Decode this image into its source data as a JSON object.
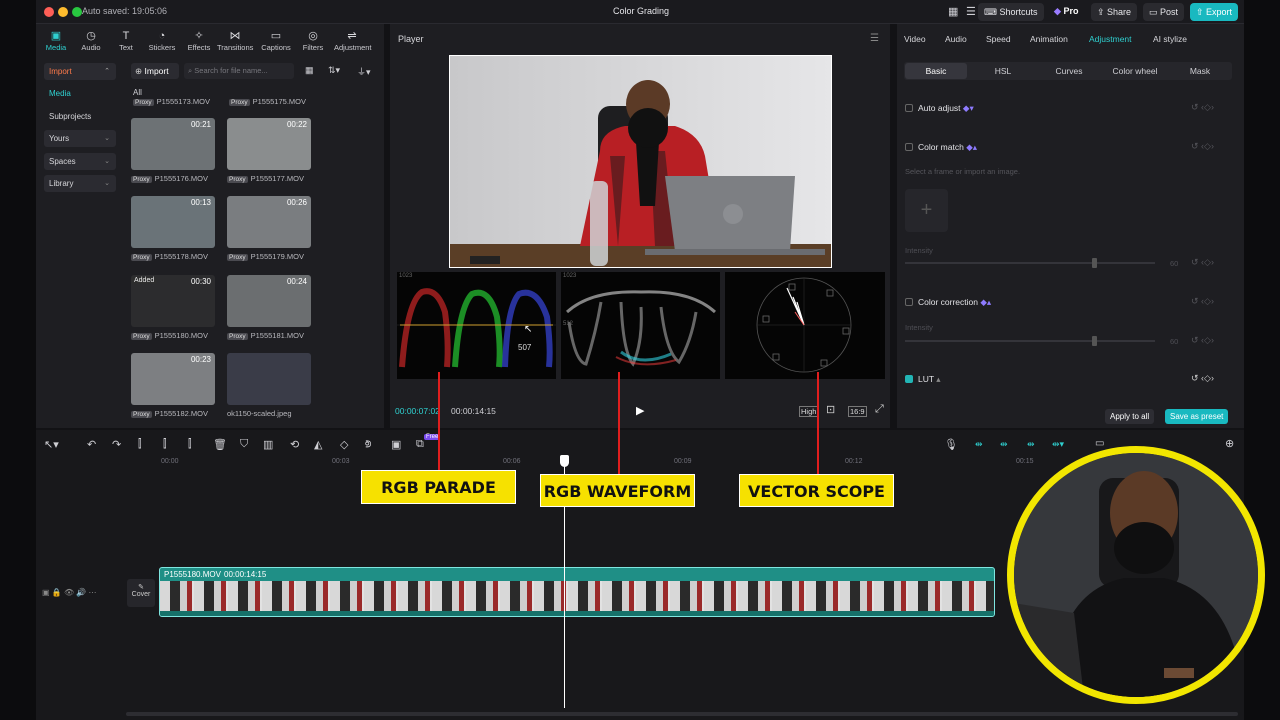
{
  "window": {
    "autosave": "Auto saved: 19:05:06",
    "title": "Color Grading"
  },
  "topbar": {
    "shortcuts": "Shortcuts",
    "pro": "Pro",
    "share": "Share",
    "post": "Post",
    "export": "Export"
  },
  "tools": [
    {
      "label": "Media",
      "icon": "media-icon",
      "glyph": "▣"
    },
    {
      "label": "Audio",
      "icon": "audio-icon",
      "glyph": "◷"
    },
    {
      "label": "Text",
      "icon": "text-icon",
      "glyph": "T"
    },
    {
      "label": "Stickers",
      "icon": "stickers-icon",
      "glyph": "◔"
    },
    {
      "label": "Effects",
      "icon": "effects-icon",
      "glyph": "✧"
    },
    {
      "label": "Transitions",
      "icon": "transitions-icon",
      "glyph": "⋈"
    },
    {
      "label": "Captions",
      "icon": "captions-icon",
      "glyph": "▭"
    },
    {
      "label": "Filters",
      "icon": "filters-icon",
      "glyph": "◎"
    },
    {
      "label": "Adjustment",
      "icon": "adjustment-icon",
      "glyph": "⇌"
    }
  ],
  "sidebar": {
    "import": "Import",
    "items": [
      "Media",
      "Subprojects",
      "Yours",
      "Spaces",
      "Library"
    ]
  },
  "media": {
    "import_button": "Import",
    "search_placeholder": "Search for file name...",
    "filter_all": "All",
    "top_names": [
      "P1555173.MOV",
      "P1555175.MOV"
    ],
    "items": [
      {
        "name": "P1555176.MOV",
        "duration": "00:21",
        "proxy": "Proxy",
        "added": ""
      },
      {
        "name": "P1555177.MOV",
        "duration": "00:22",
        "proxy": "Proxy",
        "added": ""
      },
      {
        "name": "P1555178.MOV",
        "duration": "00:13",
        "proxy": "Proxy",
        "added": ""
      },
      {
        "name": "P1555179.MOV",
        "duration": "00:26",
        "proxy": "Proxy",
        "added": ""
      },
      {
        "name": "P1555180.MOV",
        "duration": "00:30",
        "proxy": "Proxy",
        "added": "Added"
      },
      {
        "name": "P1555181.MOV",
        "duration": "00:24",
        "proxy": "Proxy",
        "added": ""
      },
      {
        "name": "P1555182.MOV",
        "duration": "00:23",
        "proxy": "Proxy",
        "added": ""
      },
      {
        "name": "ok1150-scaled.jpeg",
        "duration": "",
        "proxy": "",
        "added": ""
      }
    ]
  },
  "player": {
    "title": "Player",
    "current_time": "00:00:07:02",
    "total_time": "00:00:14:15",
    "quality": "High",
    "ratio": "16:9",
    "scopes": {
      "top_value": "1023",
      "mid_value": "512",
      "cursor_value": "507"
    }
  },
  "adjust": {
    "tabs": [
      "Video",
      "Audio",
      "Speed",
      "Animation",
      "Adjustment",
      "AI stylize"
    ],
    "active_tab": "Adjustment",
    "subtabs": [
      "Basic",
      "HSL",
      "Curves",
      "Color wheel",
      "Mask"
    ],
    "auto_adjust": "Auto adjust",
    "color_match": "Color match",
    "color_match_hint": "Select a frame or import an image.",
    "intensity": "Intensity",
    "intensity_value": "60",
    "color_correction": "Color correction",
    "lut": "LUT",
    "apply_all": "Apply to all",
    "save_preset": "Save as preset"
  },
  "timeline": {
    "ticks": [
      "00:00",
      "00:03",
      "00:06",
      "00:09",
      "00:12",
      "00:15"
    ],
    "clip_name": "P1555180.MOV",
    "clip_duration": "00:00:14:15",
    "cover": "Cover",
    "free_badge": "Free"
  },
  "callouts": {
    "parade": "RGB PARADE",
    "waveform": "RGB WAVEFORM",
    "vector": "VECTOR SCOPE"
  },
  "colors": {
    "accent": "#22c4c8",
    "callout": "#f6e100",
    "ring": "#f2e600"
  }
}
